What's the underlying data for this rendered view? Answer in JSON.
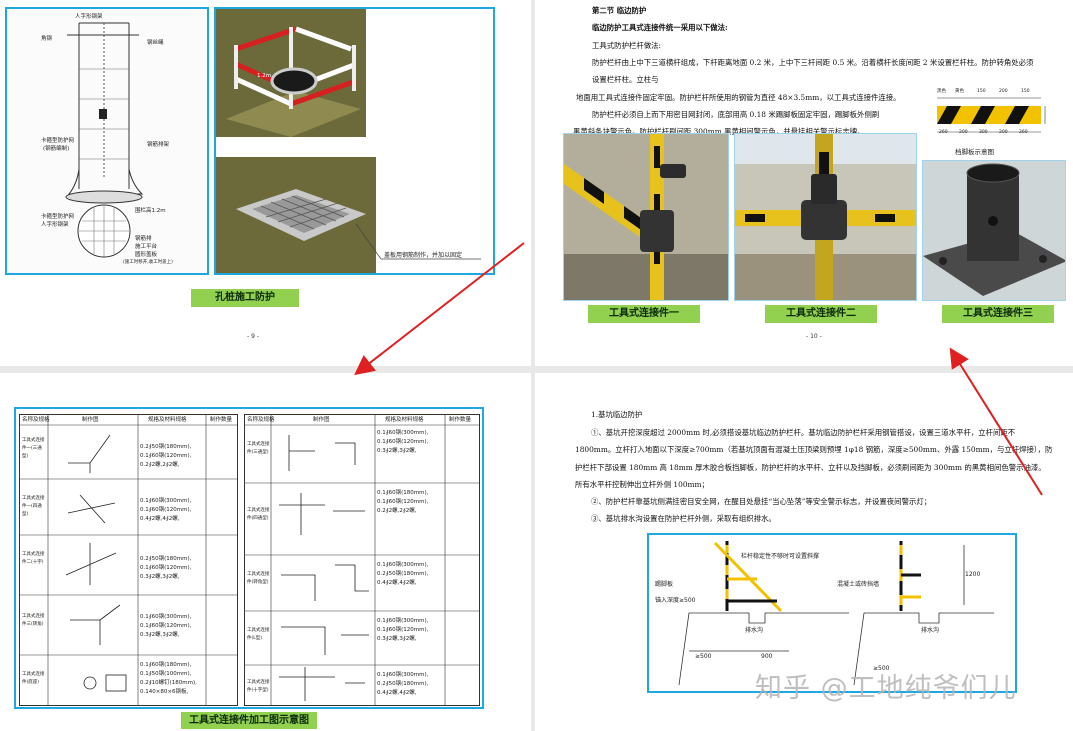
{
  "page1": {
    "caption": "孔桩施工防护",
    "page_number": "- 9 -",
    "annotation_top": "人字形钢架",
    "annotation_left_top": "角钢",
    "annotation_left_mid1": "卡箍型防护网",
    "annotation_left_mid2": "(钢筋编制)",
    "annotation_right1": "钢丝绳",
    "annotation_right2": "钢筋排架",
    "annotation_right3": "围栏高1.2m",
    "annotation_left_low1": "卡箍型防护网",
    "annotation_left_low2": "人字形钢架",
    "annotation_right_low1": "钢筋排",
    "annotation_right_low2": "施工平台",
    "annotation_right_low3": "圆形盖板",
    "annotation_right_low4": "(施工时移开,收工时盖上)",
    "render_note": "盖板用钢筋制作，并加以固定",
    "diagram_label_mid": "1.2m"
  },
  "page2": {
    "section": "第二节   临边防护",
    "lines": [
      "临边防护工具式连接件统一采用以下做法:",
      "工具式防护栏杆做法:",
      "防护栏杆由上中下三道横杆组成，下杆距离地面 0.2 米，上中下三杆间距 0.5 米。沿着横杆长度间距 2 米设置栏杆柱。防护转角处必须",
      "设置栏杆柱。立柱与",
      "地面用工具式连接件固定牢固。防护栏杆所使用的钢管为直径 48×3.5mm，以工具式连接件连接。",
      "防护栏杆必须自上而下用密目网封闭，底部用高 0.18 米踢脚板固定牢固，踢脚板外侧刷",
      "黑黄斜条块警示色。防护栏杆刷间距 300mm 黑黄相间警示色，并悬挂相关警示标志牌。"
    ],
    "toeboard_caption": "档脚板示意图",
    "toeboard_labels": [
      "黑色",
      "黄色",
      "150",
      "200",
      "150",
      "260",
      "200",
      "300",
      "200",
      "260"
    ],
    "captions": [
      "工具式连接件一",
      "工具式连接件二",
      "工具式连接件三"
    ],
    "page_number": "- 10 -"
  },
  "page3": {
    "caption": "工具式连接件加工图示意图",
    "header_left": [
      "名称及规格",
      "制作图",
      "规格及材料规格",
      "制作数量"
    ],
    "header_right": [
      "名称及规格",
      "制作图",
      "规格及材料规格",
      "制作数量"
    ],
    "rows_left": [
      {
        "name": "工具式连接件一(三通型)",
        "spec": [
          "0.2∮50钢(180mm),",
          "0.1∮60钢(120mm),",
          "0.2∮2螺,2∮2螺,"
        ]
      },
      {
        "name": "工具式连接件一(四通型)",
        "spec": [
          "0.1∮60钢(300mm),",
          "0.1∮60钢(120mm),",
          "0.4∮2螺,4∮2螺,"
        ]
      },
      {
        "name": "工具式连接件二(十字)",
        "spec": [
          "0.2∮50钢(180mm),",
          "0.1∮60钢(120mm),",
          "0.3∮2螺,3∮2螺,"
        ]
      },
      {
        "name": "工具式连接件三(转角)",
        "spec": [
          "0.1∮60钢(300mm),",
          "0.1∮60钢(120mm),",
          "0.3∮2螺,3∮2螺,"
        ]
      },
      {
        "name": "工具式连接件(底座)",
        "spec": [
          "0.1∮60钢(180mm),",
          "0.1∮50钢(100mm),",
          "0.2∮10螺钉(180mm),",
          "0.140×80×6钢板,"
        ]
      }
    ],
    "rows_right": [
      {
        "name": "工具式连接件(三通型)",
        "spec": [
          "0.1∮60钢(300mm),",
          "0.1∮60钢(120mm),",
          "0.3∮2螺,3∮2螺,"
        ]
      },
      {
        "name": "工具式连接件(四通型)",
        "spec": [
          "0.1∮60钢(180mm),",
          "0.1∮60钢(120mm),",
          "0.2∮2螺,2∮2螺,"
        ]
      },
      {
        "name": "工具式连接件(转角型)",
        "spec": [
          "0.1∮60钢(300mm),",
          "0.2∮50钢(180mm),",
          "0.4∮2螺,4∮2螺,"
        ]
      },
      {
        "name": "工具式连接件(L型)",
        "spec": [
          "0.1∮60钢(300mm),",
          "0.1∮60钢(120mm),",
          "0.3∮2螺,3∮2螺,"
        ]
      },
      {
        "name": "工具式连接件(十字型)",
        "spec": [
          "0.1∮60钢(300mm),",
          "0.2∮50钢(180mm),",
          "0.4∮2螺,4∮2螺,"
        ]
      }
    ]
  },
  "page4": {
    "heading": "1.基坑临边防护",
    "lines": [
      "①、基坑开挖深度超过 2000mm 时,必须搭设基坑临边防护栏杆。基坑临边防护栏杆采用钢管搭设，设置三道水平杆，立杆间距不",
      "1800mm。立杆打入地面以下深度≥700mm（若基坑顶面有混凝土压顶梁则预埋 1φ18 钢筋，深度≥500mm、外露 150mm，与立杆焊接），防",
      "护栏杆下部设置 180mm 高 18mm 厚木胶合板挡脚板，防护栏杆的水平杆、立杆以及挡脚板，必须刷间距为 300mm 的黑黄相间色警示油漆。",
      "所有水平杆控制伸出立杆外侧 100mm；",
      "②、防护栏杆靠基坑侧满挂密目安全网，在醒目处悬挂“当心坠落”等安全警示标志，并设置夜间警示灯；",
      "③、基坑排水沟设置在防护栏杆外侧，采取有组织排水。"
    ],
    "diagram_labels": {
      "top_note": "栏杆稳定性不够时可设置斜撑",
      "toeboard": "踢脚板",
      "embed": "锚入深度≥500",
      "ditch_left": "排水沟",
      "ditch_right": "排水沟",
      "concrete": "混凝土或砖挡墙",
      "height": "1200",
      "dim1": "≥500",
      "dim2": "900",
      "dim3": "≥500"
    },
    "watermark": "知乎 @工地纯爷们儿"
  },
  "colors": {
    "frame_blue": "#1fa7e0",
    "caption_green": "#92d050",
    "arrow_red": "#e02020",
    "yellow": "#f2c200",
    "red_bar": "#d62020"
  }
}
